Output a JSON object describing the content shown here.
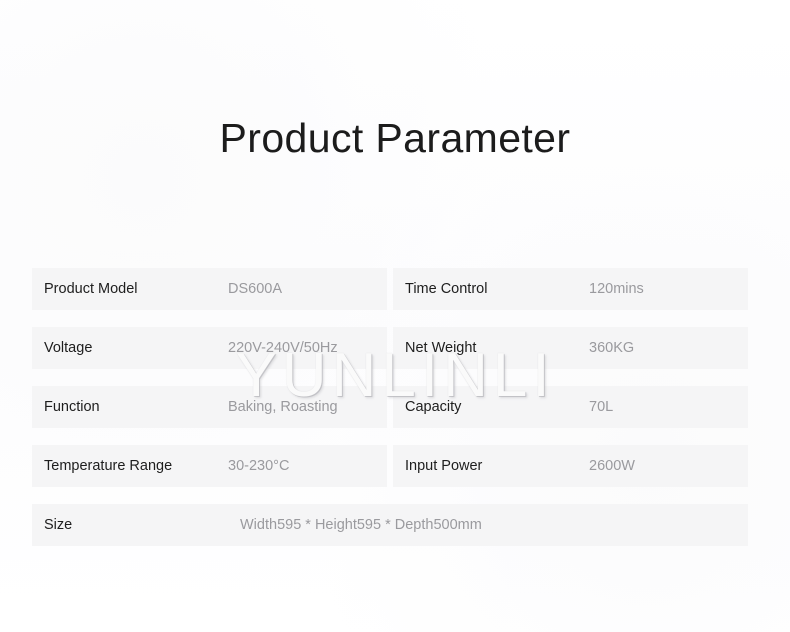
{
  "page": {
    "title": "Product Parameter",
    "watermark": "YUNLINLI",
    "band_color": "#f5f5f6",
    "label_color": "#1e1e1e",
    "value_color": "#9a9a9e"
  },
  "table": {
    "rows": [
      {
        "left": {
          "label": "Product Model",
          "value": "DS600A"
        },
        "right": {
          "label": "Time Control",
          "value": "120mins"
        }
      },
      {
        "left": {
          "label": "Voltage",
          "value": "220V-240V/50Hz"
        },
        "right": {
          "label": "Net Weight",
          "value": "360KG"
        }
      },
      {
        "left": {
          "label": "Function",
          "value": "Baking, Roasting"
        },
        "right": {
          "label": "Capacity",
          "value": "70L"
        }
      },
      {
        "left": {
          "label": "Temperature Range",
          "value": "30-230°C"
        },
        "right": {
          "label": "Input Power",
          "value": "2600W"
        }
      }
    ],
    "full_row": {
      "label": "Size",
      "value": "Width595 * Height595 * Depth500mm"
    }
  }
}
